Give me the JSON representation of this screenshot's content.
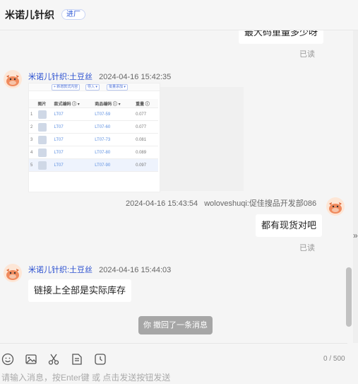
{
  "header": {
    "shop_name": "米诺儿针织",
    "status_badge": "进厂"
  },
  "messages": {
    "m0": {
      "text": "最大码重量多少呀",
      "status": "已读"
    },
    "m1": {
      "sender": "米诺儿针织:土豆丝",
      "time": "2024-04-16 15:42:35"
    },
    "m2": {
      "time": "2024-04-16 15:43:54",
      "sender": "woloveshuqi:促佳搜品开发部086",
      "text": "都有现货对吧",
      "status": "已读"
    },
    "m3": {
      "sender": "米诺儿针织:土豆丝",
      "time": "2024-04-16 15:44:03",
      "text": "链接上全部是实际库存"
    },
    "recall_notice": "你 撤回了一条消息"
  },
  "image_table": {
    "toolbar": [
      "+ 新增款式内容",
      "导入 ▾",
      "批量添加 ▾"
    ],
    "headers": [
      "",
      "图片",
      "款式编码 ⓘ ▾",
      "商品编码 ⓘ ▾",
      "重量 ⓘ"
    ],
    "rows": [
      {
        "n": "1",
        "style": "LT07",
        "code": "LT07-59",
        "weight": "0.077"
      },
      {
        "n": "2",
        "style": "LT07",
        "code": "LT07-60",
        "weight": "0.077"
      },
      {
        "n": "3",
        "style": "LT07",
        "code": "LT07-73",
        "weight": "0.081"
      },
      {
        "n": "4",
        "style": "LT07",
        "code": "LT07-80",
        "weight": "0.089"
      },
      {
        "n": "5",
        "style": "LT07",
        "code": "LT07-90",
        "weight": "0.097"
      }
    ]
  },
  "composer": {
    "counter": "0 / 500",
    "placeholder": "请输入消息，按Enter键 或 点击发送按钮发送"
  },
  "icons": [
    "emoji-icon",
    "image-icon",
    "scissors-icon",
    "document-icon",
    "history-icon"
  ],
  "colors": {
    "accent": "#2a4fd0",
    "recall_bg": "#a6a6a6"
  }
}
